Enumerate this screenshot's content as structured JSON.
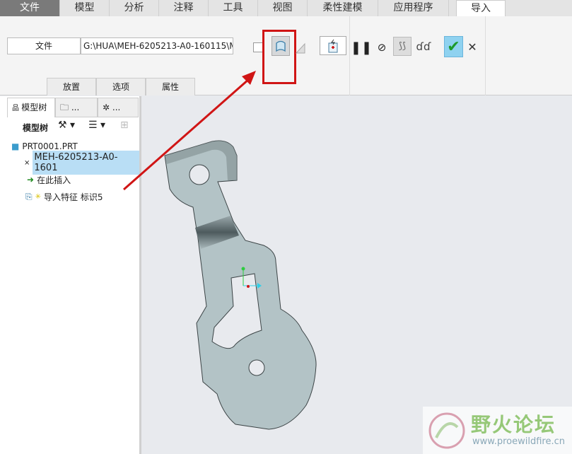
{
  "menu_tabs": [
    "文件",
    "模型",
    "分析",
    "注释",
    "工具",
    "视图",
    "柔性建模",
    "应用程序",
    "导入"
  ],
  "ribbon": {
    "file_button": "文件",
    "file_path": "G:\\HUA\\MEH-6205213-A0-160115\\M",
    "sub_tabs": [
      "放置",
      "选项",
      "属性"
    ],
    "ok_symbol": "✔",
    "cancel_symbol": "✕"
  },
  "panel": {
    "tabs": [
      "模型树",
      "...",
      "..."
    ],
    "toolbar_label": "模型树"
  },
  "tree": {
    "root": "PRT0001.PRT",
    "items": [
      "MEH-6205213-A0-1601",
      "在此插入",
      "导入特征 标识5"
    ]
  },
  "watermark": {
    "title": "野火论坛",
    "url": "www.proewildfire.cn"
  },
  "colors": {
    "highlight": "#cc1111",
    "selected_row": "#b9def5",
    "part": "#b3c3c6"
  }
}
